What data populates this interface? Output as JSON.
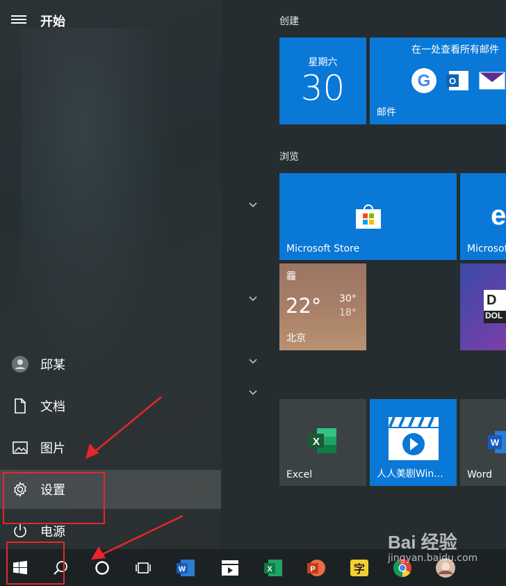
{
  "start": {
    "title": "开始"
  },
  "nav": {
    "user": "邱某",
    "documents": "文档",
    "pictures": "图片",
    "settings": "设置",
    "power": "电源"
  },
  "groups": {
    "create": "创建",
    "browse": "浏览"
  },
  "tiles": {
    "calendar": {
      "day": "星期六",
      "date": "30"
    },
    "mail": {
      "headline": "在一处查看所有邮件",
      "label": "邮件"
    },
    "store": {
      "label": "Microsoft Store"
    },
    "edge": {
      "label": "Microsoft"
    },
    "weather": {
      "condition": "霾",
      "temp": "22°",
      "high": "30°",
      "low": "18°",
      "city": "北京"
    },
    "dolby": {
      "label": "DOL"
    },
    "excel": {
      "label": "Excel"
    },
    "rrmj": {
      "label": "人人美剧Win..."
    },
    "word": {
      "label": "Word"
    }
  },
  "taskbar": {
    "icons": [
      "windows-start-icon",
      "search-icon",
      "cortana-icon",
      "task-view-icon",
      "word-icon",
      "movie-app-icon",
      "excel-icon",
      "powerpoint-icon",
      "dictionary-icon",
      "chrome-icon",
      "avatar-app-icon"
    ]
  },
  "watermark": {
    "text": "Bai 经验",
    "sub": "jingyan.baidu.com"
  },
  "colors": {
    "tile_blue": "#0a78d7",
    "annotation_red": "#e8262a"
  }
}
